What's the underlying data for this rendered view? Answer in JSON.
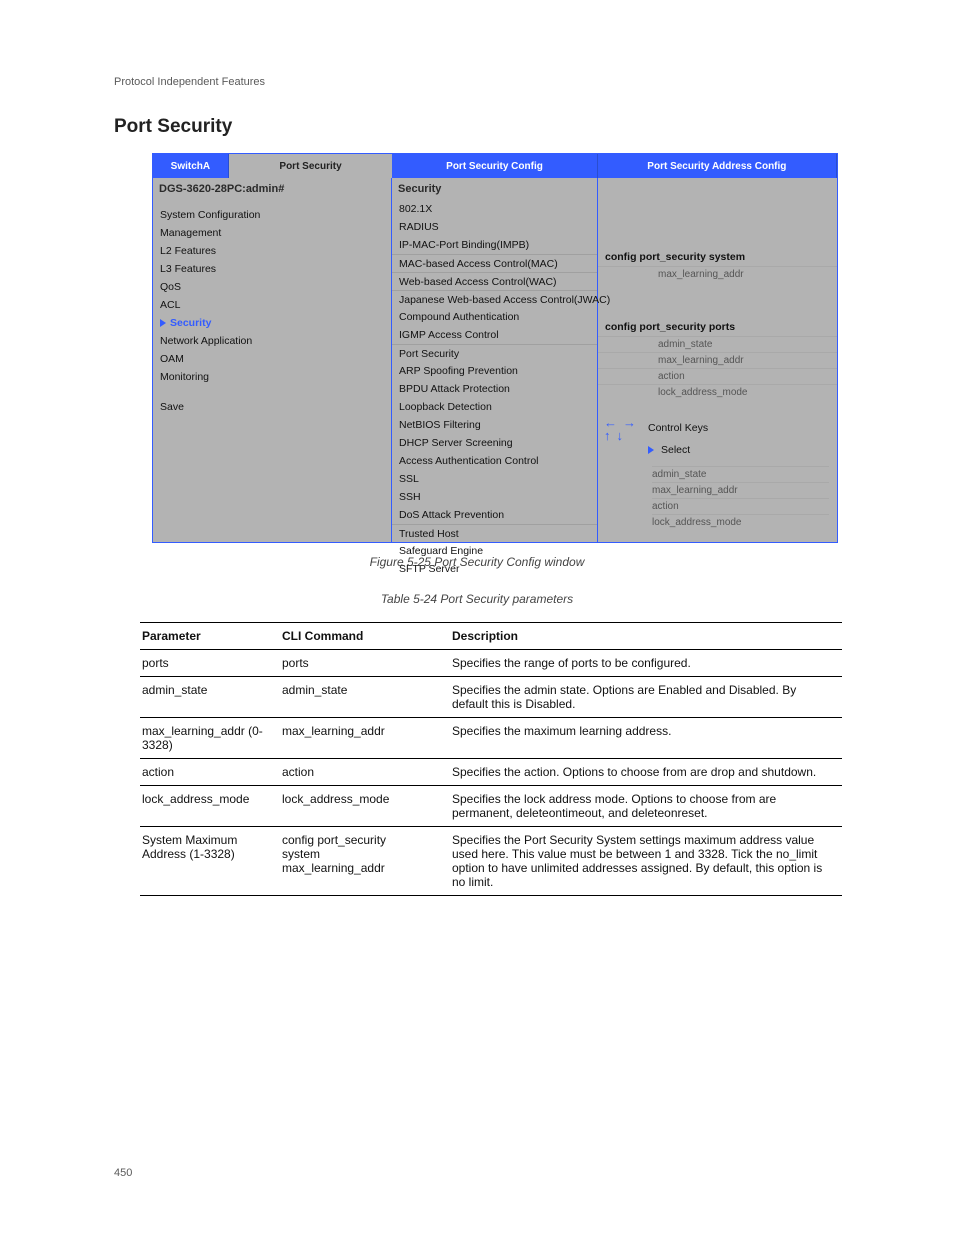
{
  "header_label": "Protocol Independent Features",
  "section_title": "Port Security",
  "menu": {
    "tabs": [
      "SwitchA",
      "Port Security",
      "Port Security Config",
      "Port Security Address Config"
    ],
    "active_tab_index": 1,
    "col_a": {
      "title": "DGS-3620-28PC:admin#",
      "items": [
        "System Configuration",
        "Management",
        "L2 Features",
        "L3 Features",
        "QoS",
        "ACL",
        "Security",
        "Network Application",
        "OAM",
        "Monitoring",
        "Save"
      ],
      "selected_index": 6
    },
    "col_b": {
      "title": "Security",
      "items": [
        "802.1X",
        "RADIUS",
        "IP-MAC-Port Binding(IMPB)",
        "MAC-based Access Control(MAC)",
        "Web-based Access Control(WAC)",
        "Japanese Web-based Access Control(JWAC)",
        "Compound Authentication",
        "IGMP Access Control",
        "Port Security",
        "ARP Spoofing Prevention",
        "BPDU Attack Protection",
        "Loopback Detection",
        "NetBIOS Filtering",
        "DHCP Server Screening",
        "Access Authentication Control",
        "SSL",
        "SSH",
        "DoS Attack Prevention",
        "Trusted Host",
        "Safeguard Engine",
        "SFTP Server"
      ],
      "break_after": [
        2,
        7
      ]
    },
    "col_c": {
      "group1": {
        "title": "config port_security system",
        "items": [
          "max_learning_addr"
        ]
      },
      "group2": {
        "title": "config port_security ports",
        "items": [
          "admin_state",
          "max_learning_addr",
          "action",
          "lock_address_mode"
        ]
      },
      "controls_label": "Control Keys",
      "select_label": "Select"
    }
  },
  "figure_caption": "Figure 5-25 Port Security Config window",
  "table_caption": "Table 5-24 Port Security parameters",
  "table": {
    "headers": [
      "Parameter",
      "CLI Command",
      "Description"
    ],
    "rows": [
      [
        "ports",
        "ports",
        "Specifies the range of ports to be configured."
      ],
      [
        "admin_state",
        "admin_state",
        "Specifies the admin state. Options are Enabled and\nDisabled. By default this is Disabled."
      ],
      [
        "max_learning_addr (0-3328)",
        "max_learning_addr",
        "Specifies the maximum learning address."
      ],
      [
        "action",
        "action",
        "Specifies the action. Options to choose from are drop\nand shutdown."
      ],
      [
        "lock_address_mode",
        "lock_address_mode",
        "Specifies the lock address mode. Options to choose\nfrom are permanent, deleteontimeout, and deleteonreset."
      ],
      [
        "System Maximum Address (1-3328)",
        "config port_security\nsystem\nmax_learning_addr",
        "Specifies the Port Security System settings maximum\naddress value used here. This value must be between 1\nand 3328. Tick the no_limit option to have unlimited\naddresses assigned. By default, this option is no limit."
      ]
    ]
  },
  "page_number": "450"
}
